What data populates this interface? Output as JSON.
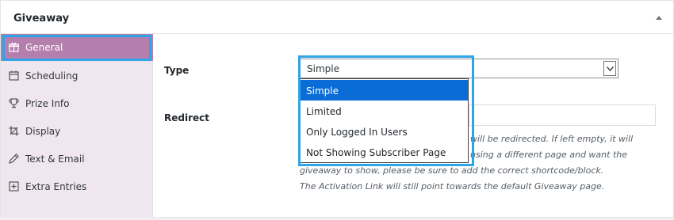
{
  "panel": {
    "title": "Giveaway"
  },
  "sidebar": {
    "tabs": [
      {
        "label": "General",
        "icon": "gift-icon",
        "active": true
      },
      {
        "label": "Scheduling",
        "icon": "calendar-icon",
        "active": false
      },
      {
        "label": "Prize Info",
        "icon": "trophy-icon",
        "active": false
      },
      {
        "label": "Display",
        "icon": "crop-icon",
        "active": false
      },
      {
        "label": "Text & Email",
        "icon": "pencil-icon",
        "active": false
      },
      {
        "label": "Extra Entries",
        "icon": "plus-box-icon",
        "active": false
      }
    ]
  },
  "form": {
    "type_label": "Type",
    "type_value": "Simple",
    "type_options": [
      "Simple",
      "Limited",
      "Only Logged In Users",
      "Not Showing Subscriber Page"
    ],
    "redirect_label": "Redirect",
    "help_lines": [
      "will be redirected. If left empty, it will",
      "using a different page and want the",
      "giveaway to show, please be sure to add the correct shortcode/block.",
      "The Activation Link will still point towards the default Giveaway page."
    ]
  },
  "colors": {
    "active_tab": "#b57fad",
    "sidebar_bg": "#f0e6ef",
    "highlight_outline": "#2fa4e7",
    "selected_option": "#0a6cd6"
  }
}
